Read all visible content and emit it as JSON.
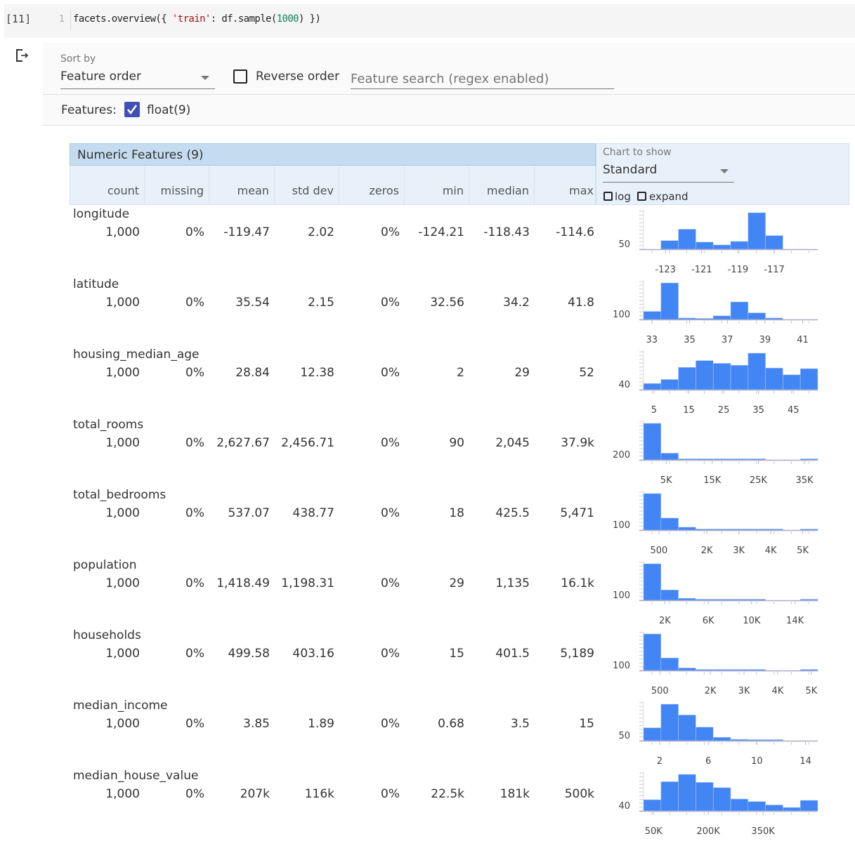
{
  "cell": {
    "prompt": "[11]",
    "line_number": "1",
    "code_prefix": "facets.overview({ ",
    "code_string": "'train'",
    "code_mid": ": df.sample(",
    "code_number": "1000",
    "code_suffix": ") })"
  },
  "controls": {
    "sort_by_label": "Sort by",
    "sort_by_value": "Feature order",
    "reverse_order_label": "Reverse order",
    "reverse_order_checked": false,
    "search_placeholder": "Feature search (regex enabled)",
    "features_label": "Features:",
    "feature_type_label": "float(9)",
    "feature_type_checked": true
  },
  "table": {
    "title": "Numeric Features (9)",
    "columns": [
      "count",
      "missing",
      "mean",
      "std dev",
      "zeros",
      "min",
      "median",
      "max"
    ],
    "chart_to_show_label": "Chart to show",
    "chart_to_show_value": "Standard",
    "log_label": "log",
    "expand_label": "expand",
    "accent_color": "#4285f4",
    "rows": [
      {
        "name": "longitude",
        "values": [
          "1,000",
          "0%",
          "-119.47",
          "2.02",
          "0%",
          "-124.21",
          "-118.43",
          "-114.6"
        ]
      },
      {
        "name": "latitude",
        "values": [
          "1,000",
          "0%",
          "35.54",
          "2.15",
          "0%",
          "32.56",
          "34.2",
          "41.8"
        ]
      },
      {
        "name": "housing_median_age",
        "values": [
          "1,000",
          "0%",
          "28.84",
          "12.38",
          "0%",
          "2",
          "29",
          "52"
        ]
      },
      {
        "name": "total_rooms",
        "values": [
          "1,000",
          "0%",
          "2,627.67",
          "2,456.71",
          "0%",
          "90",
          "2,045",
          "37.9k"
        ]
      },
      {
        "name": "total_bedrooms",
        "values": [
          "1,000",
          "0%",
          "537.07",
          "438.77",
          "0%",
          "18",
          "425.5",
          "5,471"
        ]
      },
      {
        "name": "population",
        "values": [
          "1,000",
          "0%",
          "1,418.49",
          "1,198.31",
          "0%",
          "29",
          "1,135",
          "16.1k"
        ]
      },
      {
        "name": "households",
        "values": [
          "1,000",
          "0%",
          "499.58",
          "403.16",
          "0%",
          "15",
          "401.5",
          "5,189"
        ]
      },
      {
        "name": "median_income",
        "values": [
          "1,000",
          "0%",
          "3.85",
          "1.89",
          "0%",
          "0.68",
          "3.5",
          "15"
        ]
      },
      {
        "name": "median_house_value",
        "values": [
          "1,000",
          "0%",
          "207k",
          "116k",
          "0%",
          "22.5k",
          "181k",
          "500k"
        ]
      }
    ]
  },
  "chart_data": [
    {
      "type": "bar",
      "feature": "longitude",
      "xlim": [
        -124.21,
        -114.6
      ],
      "counts": [
        0,
        88,
        204,
        73,
        44,
        80,
        372,
        139,
        0,
        0
      ],
      "ytick_label": "50",
      "xticks": [
        {
          "v": -123,
          "l": "-123"
        },
        {
          "v": -121,
          "l": "-121"
        },
        {
          "v": -119,
          "l": "-119"
        },
        {
          "v": -117,
          "l": "-117"
        }
      ]
    },
    {
      "type": "bar",
      "feature": "latitude",
      "xlim": [
        32.56,
        41.8
      ],
      "counts": [
        106,
        481,
        19,
        10,
        48,
        231,
        87,
        19,
        0,
        0
      ],
      "ytick_label": "100",
      "xticks": [
        {
          "v": 33,
          "l": "33"
        },
        {
          "v": 35,
          "l": "35"
        },
        {
          "v": 37,
          "l": "37"
        },
        {
          "v": 39,
          "l": "39"
        },
        {
          "v": 41,
          "l": "41"
        }
      ]
    },
    {
      "type": "bar",
      "feature": "housing_median_age",
      "xlim": [
        2,
        52
      ],
      "counts": [
        29,
        48,
        105,
        137,
        124,
        115,
        172,
        102,
        70,
        99
      ],
      "ytick_label": "40",
      "xticks": [
        {
          "v": 5,
          "l": "5"
        },
        {
          "v": 15,
          "l": "15"
        },
        {
          "v": 25,
          "l": "25"
        },
        {
          "v": 35,
          "l": "35"
        },
        {
          "v": 45,
          "l": "45"
        }
      ]
    },
    {
      "type": "bar",
      "feature": "total_rooms",
      "xlim": [
        90,
        37900
      ],
      "counts": [
        820,
        150,
        20,
        5,
        2,
        1,
        1,
        0,
        0,
        1
      ],
      "ytick_label": "200",
      "xticks": [
        {
          "v": 5000,
          "l": "5K"
        },
        {
          "v": 15000,
          "l": "15K"
        },
        {
          "v": 25000,
          "l": "25K"
        },
        {
          "v": 35000,
          "l": "35K"
        }
      ]
    },
    {
      "type": "bar",
      "feature": "total_bedrooms",
      "xlim": [
        18,
        5471
      ],
      "counts": [
        700,
        230,
        55,
        8,
        3,
        1,
        1,
        1,
        0,
        1
      ],
      "ytick_label": "100",
      "xticks": [
        {
          "v": 500,
          "l": "500"
        },
        {
          "v": 2000,
          "l": "2K"
        },
        {
          "v": 3000,
          "l": "3K"
        },
        {
          "v": 4000,
          "l": "4K"
        },
        {
          "v": 5000,
          "l": "5K"
        }
      ]
    },
    {
      "type": "bar",
      "feature": "population",
      "xlim": [
        29,
        16100
      ],
      "counts": [
        740,
        210,
        40,
        5,
        2,
        1,
        1,
        0,
        0,
        1
      ],
      "ytick_label": "100",
      "xticks": [
        {
          "v": 2000,
          "l": "2K"
        },
        {
          "v": 6000,
          "l": "6K"
        },
        {
          "v": 10000,
          "l": "10K"
        },
        {
          "v": 14000,
          "l": "14K"
        }
      ]
    },
    {
      "type": "bar",
      "feature": "households",
      "xlim": [
        15,
        5189
      ],
      "counts": [
        700,
        240,
        48,
        6,
        3,
        1,
        1,
        0,
        0,
        1
      ],
      "ytick_label": "100",
      "xticks": [
        {
          "v": 500,
          "l": "500"
        },
        {
          "v": 2000,
          "l": "2K"
        },
        {
          "v": 3000,
          "l": "3K"
        },
        {
          "v": 4000,
          "l": "4K"
        },
        {
          "v": 5000,
          "l": "5K"
        }
      ]
    },
    {
      "type": "bar",
      "feature": "median_income",
      "xlim": [
        0.68,
        15
      ],
      "counts": [
        137,
        388,
        273,
        144,
        36,
        14,
        7,
        1,
        0,
        0
      ],
      "ytick_label": "50",
      "xticks": [
        {
          "v": 2,
          "l": "2"
        },
        {
          "v": 6,
          "l": "6"
        },
        {
          "v": 10,
          "l": "10"
        },
        {
          "v": 14,
          "l": "14"
        }
      ]
    },
    {
      "type": "bar",
      "feature": "median_house_value",
      "xlim": [
        22500,
        500000
      ],
      "counts": [
        66,
        172,
        215,
        168,
        137,
        70,
        55,
        35,
        20,
        62
      ],
      "ytick_label": "40",
      "xticks": [
        {
          "v": 50000,
          "l": "50K"
        },
        {
          "v": 200000,
          "l": "200K"
        },
        {
          "v": 350000,
          "l": "350K"
        }
      ]
    }
  ]
}
